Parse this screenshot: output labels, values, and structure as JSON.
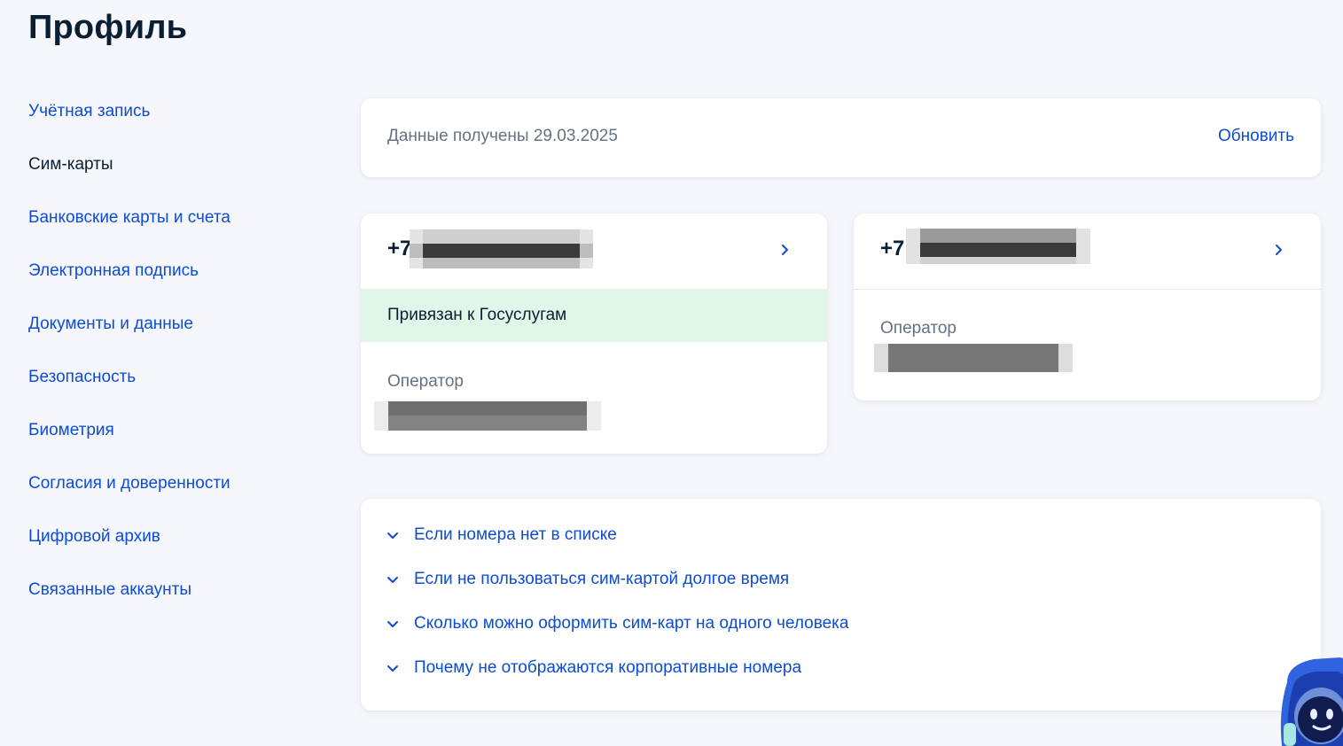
{
  "page": {
    "title": "Профиль"
  },
  "sidebar": {
    "items": [
      {
        "label": "Учётная запись",
        "active": false
      },
      {
        "label": "Сим-карты",
        "active": true
      },
      {
        "label": "Банковские карты и счета",
        "active": false
      },
      {
        "label": "Электронная подпись",
        "active": false
      },
      {
        "label": "Документы и данные",
        "active": false
      },
      {
        "label": "Безопасность",
        "active": false
      },
      {
        "label": "Биометрия",
        "active": false
      },
      {
        "label": "Согласия и доверенности",
        "active": false
      },
      {
        "label": "Цифровой архив",
        "active": false
      },
      {
        "label": "Связанные аккаунты",
        "active": false
      }
    ]
  },
  "data_status": {
    "received_text": "Данные получены 29.03.2025",
    "refresh_label": "Обновить"
  },
  "sim_cards": [
    {
      "phone_prefix": "+7",
      "status_label": "Привязан к Госуслугам",
      "operator_label": "Оператор"
    },
    {
      "phone_prefix": "+7",
      "operator_label": "Оператор"
    }
  ],
  "faq": {
    "items": [
      "Если номера нет в списке",
      "Если не пользоваться сим-картой долгое время",
      "Сколько можно оформить сим-карт на одного человека",
      "Почему не отображаются корпоративные номера"
    ]
  },
  "colors": {
    "link": "#0d4cd3",
    "text": "#0b1f33",
    "muted": "#66727f",
    "linked_band": "#e1f5e8",
    "background": "#f5f7fc"
  },
  "icons": {
    "sim_chevron": "chevron-right-icon",
    "faq_chevron": "chevron-down-icon",
    "assistant": "robot-assistant-icon"
  }
}
